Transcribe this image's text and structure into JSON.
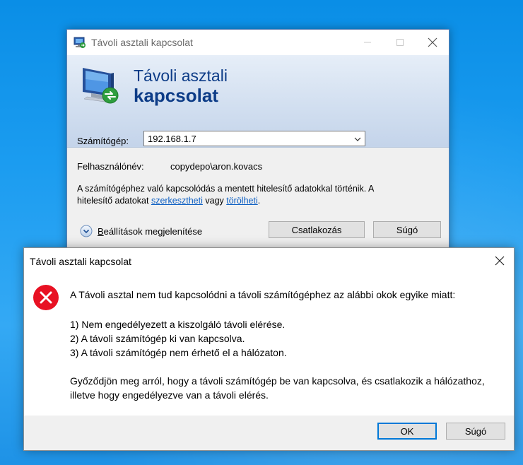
{
  "rdc_window": {
    "title": "Távoli asztali kapcsolat",
    "banner": {
      "line1": "Távoli asztali",
      "line2": "kapcsolat"
    },
    "computer_label": "Számítógép:",
    "computer_value": "192.168.1.7",
    "username_label": "Felhasználónév:",
    "username_value": "copydepo\\aron.kovacs",
    "info_part1": "A számítógéphez való kapcsolódás a mentett hitelesítő adatokkal történik. A hitelesítő adatokat ",
    "info_link_edit": "szerkesztheti",
    "info_part2": " vagy ",
    "info_link_delete": "törölheti",
    "info_part3": ".",
    "options_label_accel": "B",
    "options_label_rest": "eállítások megjelenítése",
    "connect_button": "Csatlakozás",
    "help_button": "Súgó"
  },
  "error_dialog": {
    "title": "Távoli asztali kapcsolat",
    "message": "A Távoli asztal nem tud kapcsolódni a távoli számítógéphez az alábbi okok egyike miatt:",
    "reasons": [
      "1) Nem engedélyezett a kiszolgáló távoli elérése.",
      "2) A távoli számítógép ki van kapcsolva.",
      "3) A távoli számítógép nem érhető el a hálózaton."
    ],
    "hint": "Győződjön meg arról, hogy a távoli számítógép be van kapcsolva, és csatlakozik a hálózathoz, illetve hogy engedélyezve van a távoli elérés.",
    "ok_button": "OK",
    "help_button": "Súgó"
  },
  "colors": {
    "desktop": "#1b9cf0",
    "banner_text": "#0d3c87",
    "link": "#0a5dc2",
    "error_icon": "#e81123",
    "default_button_border": "#0078d7"
  },
  "icons": {
    "rdc_app": "rdc-app-icon",
    "banner": "monitor-connection-icon",
    "options": "chevron-down-circle-icon",
    "error": "error-x-icon"
  }
}
